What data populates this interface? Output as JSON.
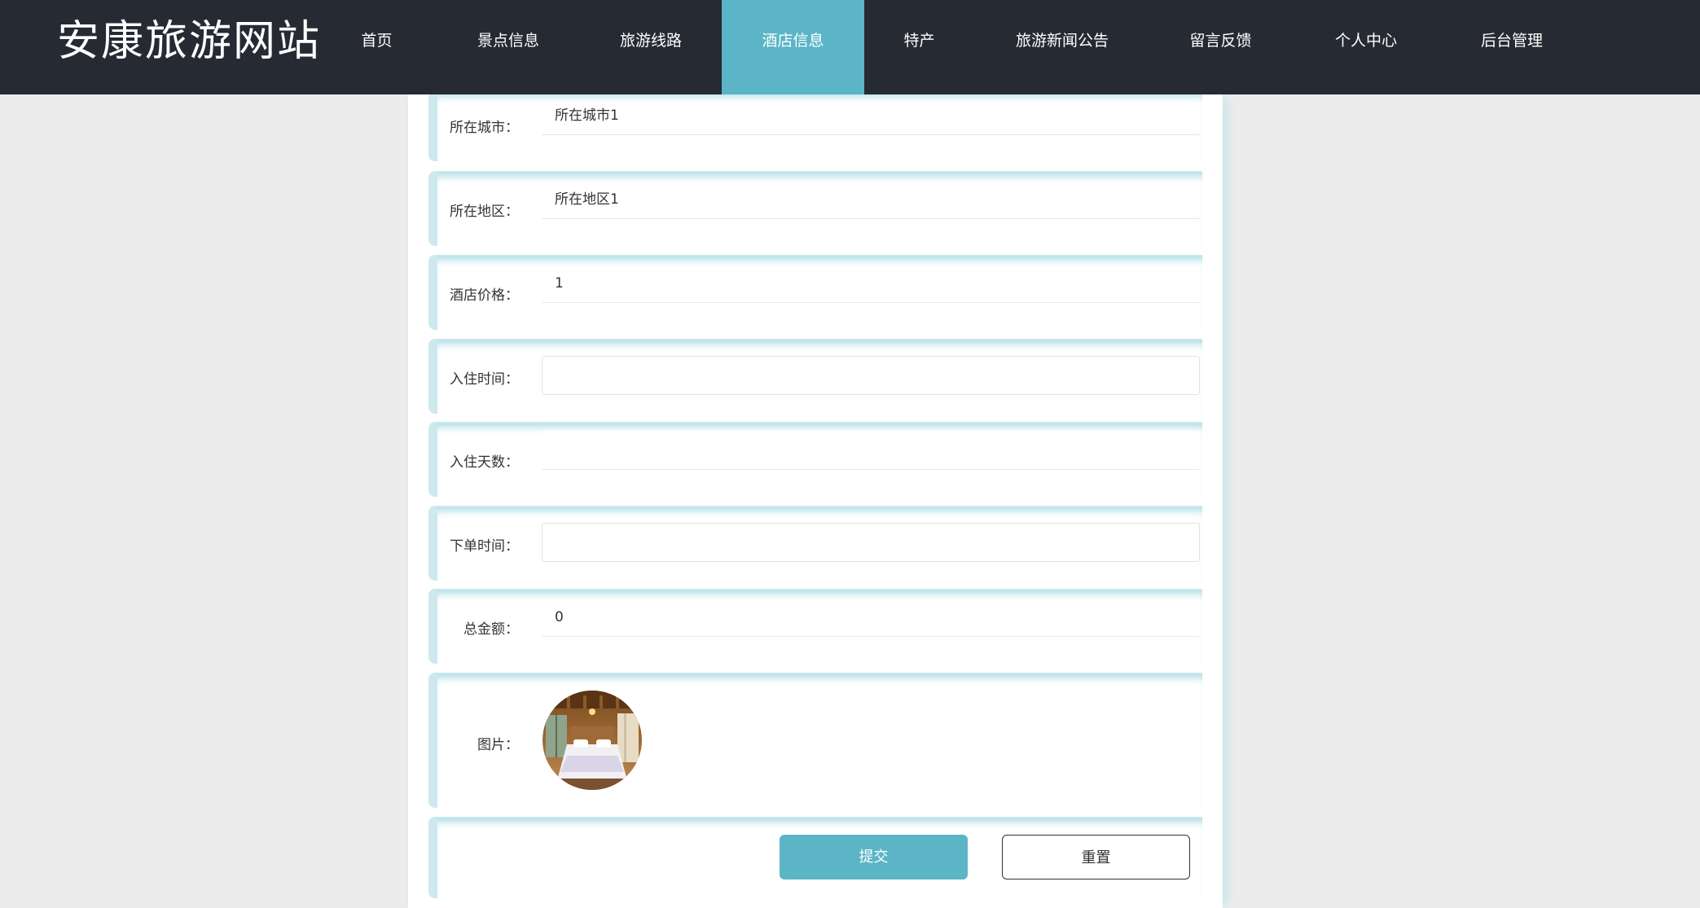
{
  "header": {
    "site_title": "安康旅游网站",
    "nav": [
      {
        "label": "首页",
        "active": false
      },
      {
        "label": "景点信息",
        "active": false
      },
      {
        "label": "旅游线路",
        "active": false
      },
      {
        "label": "酒店信息",
        "active": true
      },
      {
        "label": "特产",
        "active": false
      },
      {
        "label": "旅游新闻公告",
        "active": false
      },
      {
        "label": "留言反馈",
        "active": false
      },
      {
        "label": "个人中心",
        "active": false
      },
      {
        "label": "后台管理",
        "active": false
      }
    ]
  },
  "form": {
    "city": {
      "label": "所在城市：",
      "value": "所在城市1"
    },
    "district": {
      "label": "所在地区：",
      "value": "所在地区1"
    },
    "price": {
      "label": "酒店价格：",
      "value": "1"
    },
    "checkin_time": {
      "label": "入住时间：",
      "value": ""
    },
    "stay_days": {
      "label": "入住天数：",
      "value": ""
    },
    "order_time": {
      "label": "下单时间：",
      "value": ""
    },
    "total_amount": {
      "label": "总金额：",
      "value": "0"
    },
    "image": {
      "label": "图片：",
      "icon": "hotel-room-photo"
    },
    "submit_label": "提交",
    "reset_label": "重置"
  },
  "colors": {
    "nav_background": "#262a33",
    "accent": "#5bb5c6",
    "page_background": "#ececec"
  }
}
